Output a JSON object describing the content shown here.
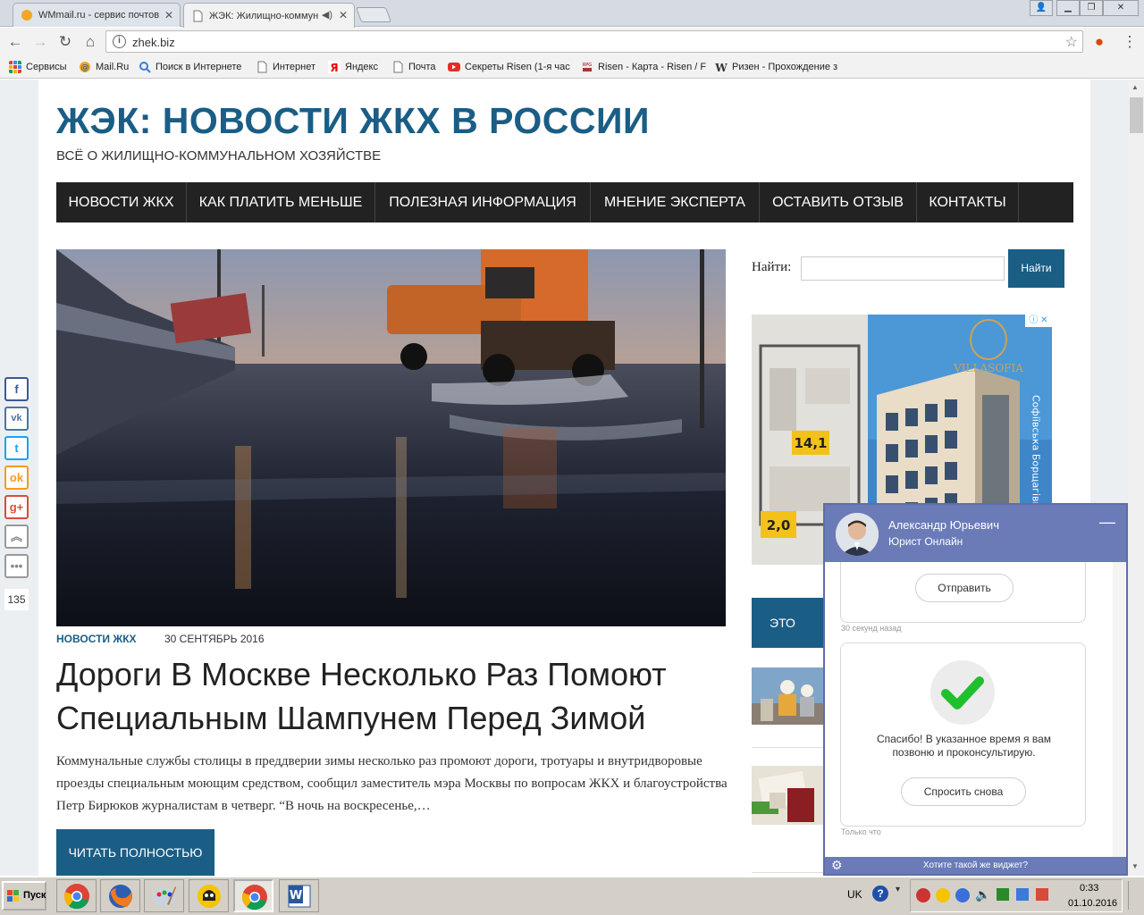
{
  "browser": {
    "tabs": [
      {
        "label": "WMmail.ru - сервис почтов"
      },
      {
        "label": "ЖЭК: Жилищно-коммун"
      }
    ],
    "url": "zhek.biz",
    "bookmarks": [
      {
        "label": "Сервисы",
        "icon": "apps-icon"
      },
      {
        "label": "Mail.Ru",
        "icon": "mailru-icon"
      },
      {
        "label": "Поиск в Интернете",
        "icon": "search-icon"
      },
      {
        "label": "Интернет",
        "icon": "page-icon"
      },
      {
        "label": "Яндекс",
        "icon": "yandex-icon"
      },
      {
        "label": "Почта",
        "icon": "page-icon"
      },
      {
        "label": "Секреты Risen (1-я час",
        "icon": "youtube-icon"
      },
      {
        "label": "Risen - Карта - Risen / F",
        "icon": "rpg-icon"
      },
      {
        "label": "Ризен - Прохождение з",
        "icon": "w-icon"
      }
    ]
  },
  "site": {
    "title": "ЖЭК: НОВОСТИ ЖКХ В РОССИИ",
    "description": "ВСЁ О ЖИЛИЩНО-КОММУНАЛЬНОМ ХОЗЯЙСТВЕ",
    "nav": [
      "НОВОСТИ ЖКХ",
      "КАК ПЛАТИТЬ МЕНЬШЕ",
      "ПОЛЕЗНАЯ ИНФОРМАЦИЯ",
      "МНЕНИЕ ЭКСПЕРТА",
      "ОСТАВИТЬ ОТЗЫВ",
      "КОНТАКТЫ"
    ]
  },
  "post": {
    "category": "НОВОСТИ ЖКХ",
    "date": "30 СЕНТЯБРЬ 2016",
    "title": "Дороги В Москве Несколько Раз Помоют Специальным Шампунем Перед Зимой",
    "excerpt": "Коммунальные службы столицы в преддверии зимы несколько раз промоют дороги, тротуары и внутридворовые проезды специальным моющим средством, сообщил заместитель мэра Москвы по вопросам ЖКХ и благоустройства Петр Бирюков журналистам в четверг. “В ночь на воскресенье,…",
    "read_more": "ЧИТАТЬ ПОЛНОСТЬЮ"
  },
  "sidebar": {
    "search_label": "Найти:",
    "search_button": "Найти",
    "ad": {
      "brand": "VILLASOFIA",
      "label1": "14,1",
      "label2": "2,0",
      "vertical_text": "Софіївська Борщагівка"
    },
    "promo_text": "ЭТО ИНТ"
  },
  "share": {
    "buttons": [
      "f",
      "vk",
      "t",
      "ok",
      "g+",
      "up",
      "more"
    ],
    "count": "135"
  },
  "chat": {
    "agent_name": "Александр Юрьевич",
    "agent_role": "Юрист Онлайн",
    "minimize": "—",
    "send_button": "Отправить",
    "time_1": "30 секунд назад",
    "thanks_text": "Спасибо! В указанное время я вам позвоню и проконсультирую.",
    "ask_again": "Спросить снова",
    "time_2": "Только что",
    "footer": "Хотите такой же виджет?"
  },
  "taskbar": {
    "start": "Пуск",
    "lang": "UK",
    "time": "0:33",
    "date": "01.10.2016"
  },
  "colors": {
    "brand": "#1a5d85",
    "nav_bg": "#222222",
    "chat": "#6a7bb8"
  }
}
